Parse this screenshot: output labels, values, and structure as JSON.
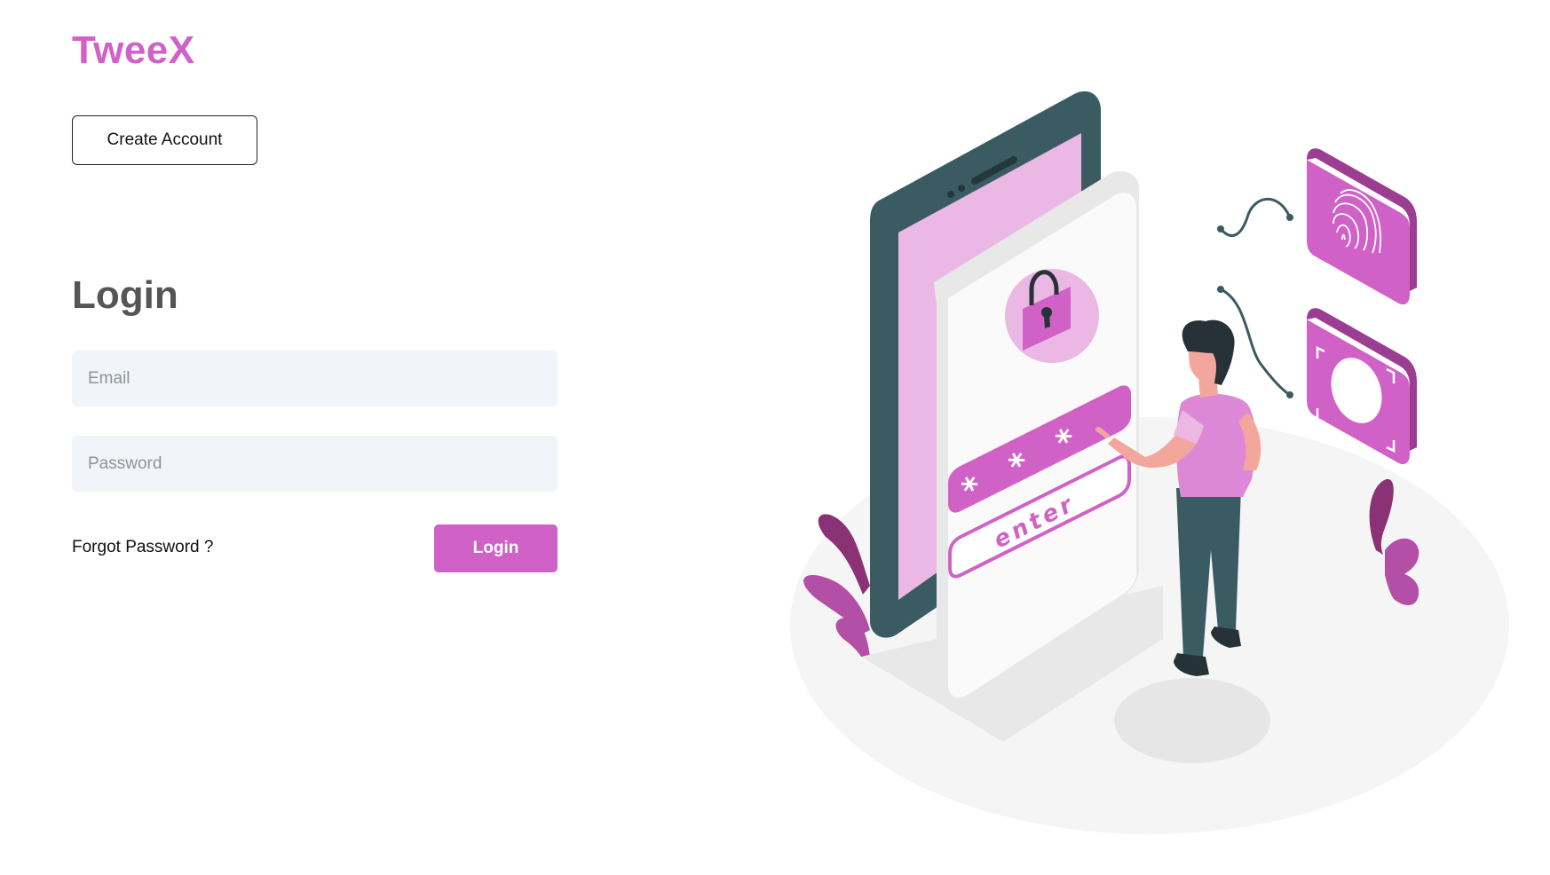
{
  "brand": {
    "name": "TweeX",
    "color": "#d062c7"
  },
  "header": {
    "create_account_label": "Create Account"
  },
  "login_form": {
    "title": "Login",
    "email_placeholder": "Email",
    "password_placeholder": "Password",
    "forgot_password_label": "Forgot Password ?",
    "submit_label": "Login"
  },
  "illustration": {
    "screen_input_label": "enter",
    "password_mask": "* * *",
    "accent_color": "#d062c7",
    "icons": [
      "lock-icon",
      "fingerprint-icon",
      "face-id-icon"
    ]
  }
}
